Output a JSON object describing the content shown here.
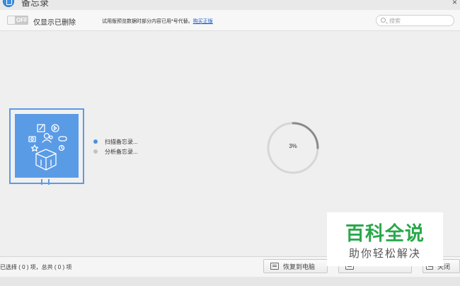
{
  "window": {
    "title": "备忘录",
    "close_glyph": "×"
  },
  "toolbar": {
    "toggle_label": "OFF",
    "toggle_state": "off",
    "filter_label": "仅显示已删除",
    "notice_text": "试用版预览数据时部分内容已用*号代替。",
    "notice_link": "购买正版",
    "search_placeholder": "搜索"
  },
  "main": {
    "steps": [
      {
        "label": "扫描备忘录...",
        "state": "active"
      },
      {
        "label": "分析备忘录...",
        "state": "pending"
      }
    ],
    "progress": {
      "text": "3%",
      "value": 3
    }
  },
  "footer": {
    "status": "已选择 ( 0 ) 项，总共 ( 0 ) 项",
    "restore_label": "恢复到电脑",
    "export_label": "",
    "close_label": "关闭"
  },
  "watermark": {
    "main": "百科全说",
    "sub": "助你轻松解决"
  },
  "colors": {
    "accent": "#5a9be6",
    "link": "#1a58c7",
    "watermark_green": "#2aa84a"
  }
}
